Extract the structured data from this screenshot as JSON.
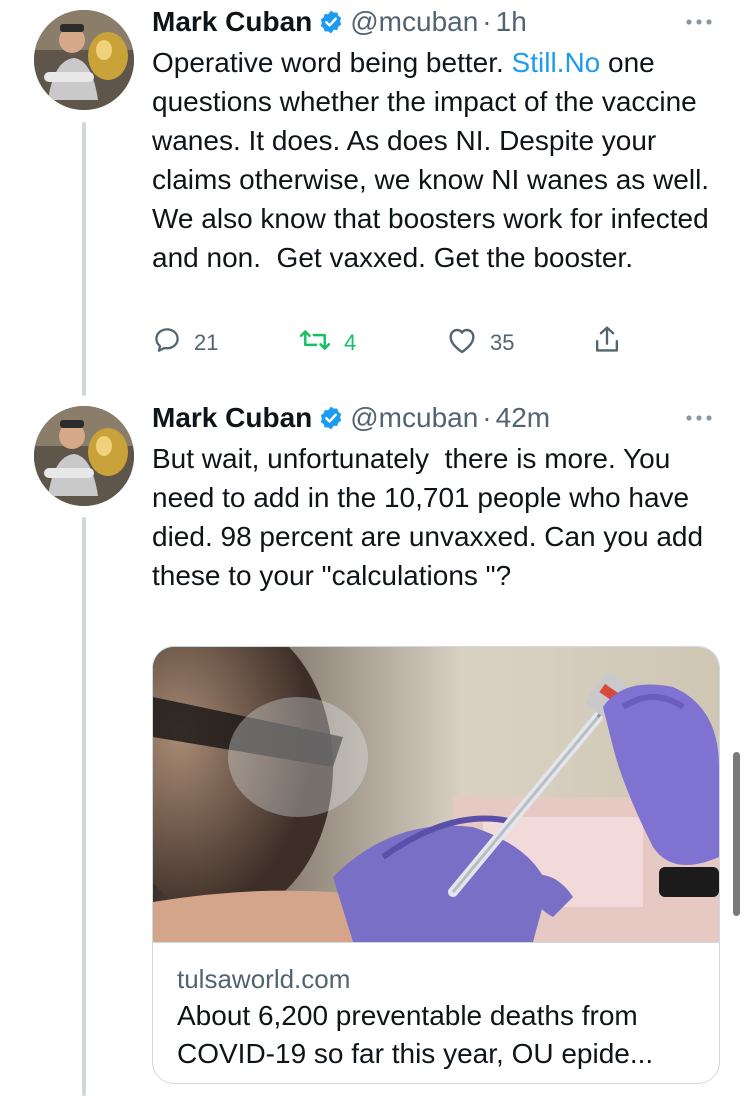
{
  "tweets": [
    {
      "author_name": "Mark Cuban",
      "handle": "@mcuban",
      "separator": "·",
      "time": "1h",
      "text_before_link": "Operative word being better. ",
      "link_text": "Still.No",
      "text_after_link": " one questions whether the impact of the vaccine wanes. It does. As does NI. Despite your claims otherwise, we know NI wanes as well. We also know that boosters work for infected and non.  Get vaxxed. Get the booster.",
      "replies": "21",
      "retweets": "4",
      "likes": "35"
    },
    {
      "author_name": "Mark Cuban",
      "handle": "@mcuban",
      "separator": "·",
      "time": "42m",
      "text": "But wait, unfortunately  there is more. You need to add in the 10,701 people who have died. 98 percent are unvaxxed. Can you add these to your \"calculations \"?",
      "card": {
        "domain": "tulsaworld.com",
        "title_line1": "About 6,200 preventable deaths from",
        "title_line2": "COVID-19 so far this year, OU epide..."
      }
    }
  ],
  "colors": {
    "link": "#1d9bf0",
    "verified": "#1d9bf0",
    "retweet": "#17bf63",
    "secondary_text": "#536471",
    "thread_line": "#cfd9de"
  },
  "icons": {
    "reply": "reply-icon",
    "retweet": "retweet-icon",
    "like": "heart-icon",
    "share": "share-icon",
    "more": "more-icon",
    "verified": "verified-badge-icon"
  }
}
